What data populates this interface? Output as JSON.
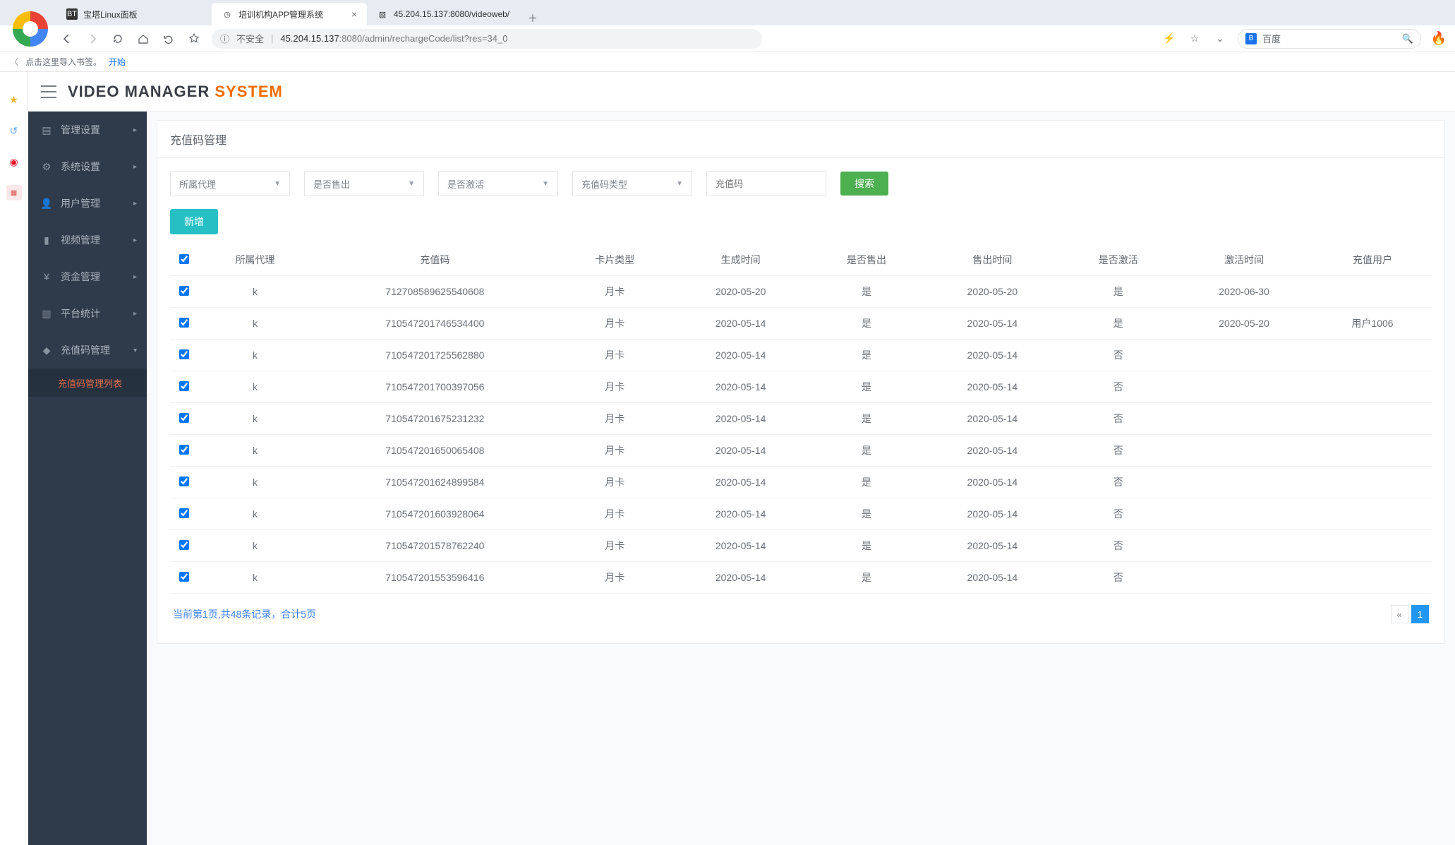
{
  "browser": {
    "tabs": [
      {
        "title": "宝塔Linux面板",
        "favicon": "BT",
        "active": false
      },
      {
        "title": "培训机构APP管理系统",
        "favicon": "◷",
        "active": true
      },
      {
        "title": "45.204.15.137:8080/videoweb/",
        "favicon": "▧",
        "active": false
      }
    ],
    "url_insecure": "不安全",
    "url_host": "45.204.15.137",
    "url_port": ":8080",
    "url_path": "/admin/rechargeCode/list?res=34_0",
    "search_placeholder": "百度",
    "bookmark_hint": "点击这里导入书签。",
    "bookmark_start": "开始"
  },
  "header": {
    "title_a": "VIDEO MANAGER ",
    "title_b": "SYSTEM"
  },
  "sidebar": {
    "items": [
      {
        "icon": "book",
        "label": "管理设置"
      },
      {
        "icon": "gears",
        "label": "系统设置"
      },
      {
        "icon": "user",
        "label": "用户管理"
      },
      {
        "icon": "camera",
        "label": "视频管理"
      },
      {
        "icon": "yen",
        "label": "资金管理"
      },
      {
        "icon": "chart",
        "label": "平台统计"
      },
      {
        "icon": "tag",
        "label": "充值码管理"
      }
    ],
    "active_sub": "充值码管理列表"
  },
  "panel": {
    "title": "充值码管理",
    "filters": {
      "agent": "所属代理",
      "sold": "是否售出",
      "activated": "是否激活",
      "type": "充值码类型",
      "code_placeholder": "充值码",
      "search_btn": "搜索"
    },
    "add_btn": "新增",
    "columns": [
      "所属代理",
      "充值码",
      "卡片类型",
      "生成时间",
      "是否售出",
      "售出时间",
      "是否激活",
      "激活时间",
      "充值用户"
    ],
    "rows": [
      {
        "agent": "k",
        "code": "712708589625540608",
        "type": "月卡",
        "gen": "2020-05-20",
        "sold": "是",
        "sold_time": "2020-05-20",
        "act": "是",
        "act_time": "2020-06-30",
        "user": ""
      },
      {
        "agent": "k",
        "code": "710547201746534400",
        "type": "月卡",
        "gen": "2020-05-14",
        "sold": "是",
        "sold_time": "2020-05-14",
        "act": "是",
        "act_time": "2020-05-20",
        "user": "用户1006"
      },
      {
        "agent": "k",
        "code": "710547201725562880",
        "type": "月卡",
        "gen": "2020-05-14",
        "sold": "是",
        "sold_time": "2020-05-14",
        "act": "否",
        "act_time": "",
        "user": ""
      },
      {
        "agent": "k",
        "code": "710547201700397056",
        "type": "月卡",
        "gen": "2020-05-14",
        "sold": "是",
        "sold_time": "2020-05-14",
        "act": "否",
        "act_time": "",
        "user": ""
      },
      {
        "agent": "k",
        "code": "710547201675231232",
        "type": "月卡",
        "gen": "2020-05-14",
        "sold": "是",
        "sold_time": "2020-05-14",
        "act": "否",
        "act_time": "",
        "user": ""
      },
      {
        "agent": "k",
        "code": "710547201650065408",
        "type": "月卡",
        "gen": "2020-05-14",
        "sold": "是",
        "sold_time": "2020-05-14",
        "act": "否",
        "act_time": "",
        "user": ""
      },
      {
        "agent": "k",
        "code": "710547201624899584",
        "type": "月卡",
        "gen": "2020-05-14",
        "sold": "是",
        "sold_time": "2020-05-14",
        "act": "否",
        "act_time": "",
        "user": ""
      },
      {
        "agent": "k",
        "code": "710547201603928064",
        "type": "月卡",
        "gen": "2020-05-14",
        "sold": "是",
        "sold_time": "2020-05-14",
        "act": "否",
        "act_time": "",
        "user": ""
      },
      {
        "agent": "k",
        "code": "710547201578762240",
        "type": "月卡",
        "gen": "2020-05-14",
        "sold": "是",
        "sold_time": "2020-05-14",
        "act": "否",
        "act_time": "",
        "user": ""
      },
      {
        "agent": "k",
        "code": "710547201553596416",
        "type": "月卡",
        "gen": "2020-05-14",
        "sold": "是",
        "sold_time": "2020-05-14",
        "act": "否",
        "act_time": "",
        "user": ""
      }
    ],
    "pager_info": "当前第1页,共48条记录，合计5页",
    "pager_prev": "«",
    "pager_current": "1"
  }
}
